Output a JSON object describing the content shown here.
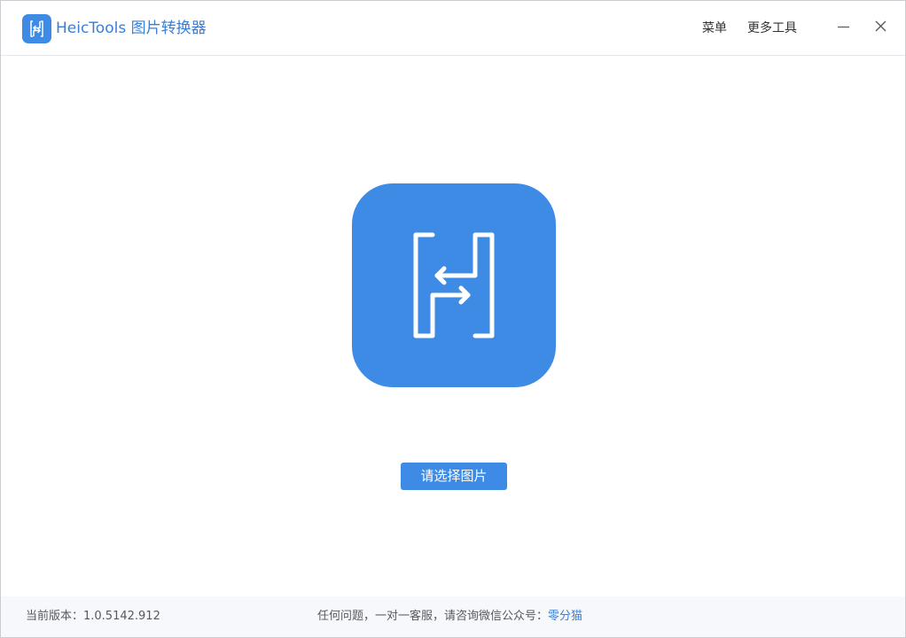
{
  "titlebar": {
    "app_title": "HeicTools 图片转换器",
    "menu_label": "菜单",
    "more_tools_label": "更多工具",
    "logo_icon": "heictools-logo-icon",
    "minimize_icon": "minimize-icon",
    "close_icon": "close-icon"
  },
  "main": {
    "hero_icon": "heictools-logo-icon",
    "select_button_label": "请选择图片"
  },
  "footer": {
    "version_text": "当前版本：1.0.5142.912",
    "support_text": "任何问题，一对一客服，请咨询微信公众号：",
    "support_account": "零分猫"
  },
  "colors": {
    "accent": "#3e8be6",
    "title_text": "#3a7fd5",
    "footer_bg": "#f6f8fb"
  }
}
